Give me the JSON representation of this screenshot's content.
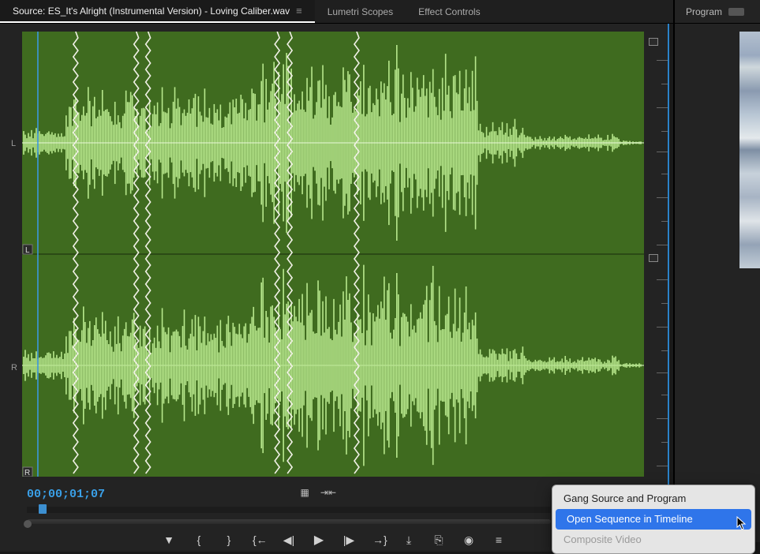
{
  "tabs": {
    "source": "Source: ES_It's Alright (Instrumental Version) - Loving Caliber.wav",
    "lumetri": "Lumetri Scopes",
    "effects": "Effect Controls",
    "program": "Program"
  },
  "monitor": {
    "channel_left": "L",
    "channel_right": "R",
    "zone_left": "L",
    "zone_right": "R"
  },
  "timecode": "00;00;01;07",
  "icons": {
    "settings": "▦",
    "insert_overwrite": "⇥⇤",
    "play": "▶",
    "step_back": "◀|",
    "step_fwd": "|▶",
    "go_in": "{←",
    "go_out": "→}",
    "mark_in": "{",
    "mark_out": "}",
    "add_marker": "▼",
    "insert": "⤓",
    "overwrite": "⎘",
    "export": "◉",
    "wrench": "≡"
  },
  "context_menu": {
    "item1": "Gang Source and Program",
    "item2": "Open Sequence in Timeline",
    "item3": "Composite Video"
  }
}
